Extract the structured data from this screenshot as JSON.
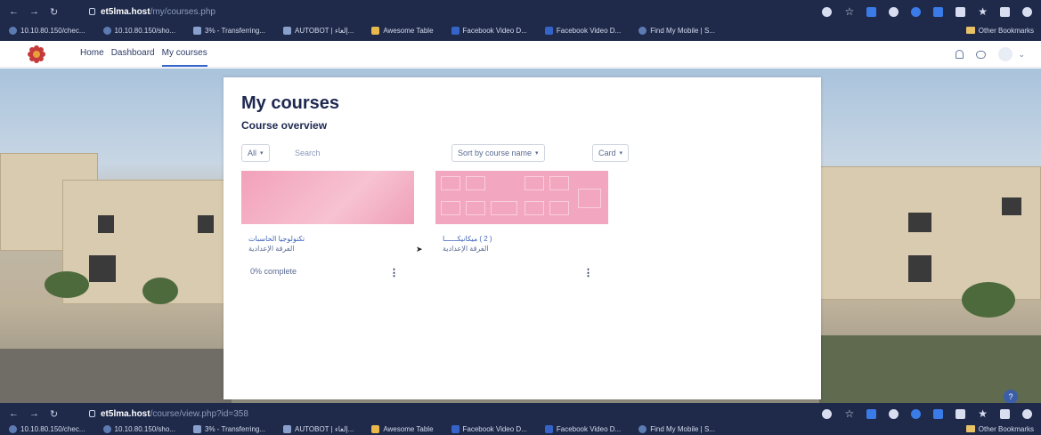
{
  "browser_top": {
    "url_host": "et5lma.host",
    "url_path": "/my/courses.php",
    "bookmarks": [
      "10.10.80.150/chec...",
      "10.10.80.150/sho...",
      "3% - Transferring...",
      "AUTOBOT | إلغاء...",
      "Awesome Table",
      "Facebook Video D...",
      "Facebook Video D...",
      "Find My Mobile | S..."
    ],
    "other_bookmarks": "Other Bookmarks"
  },
  "browser_bottom": {
    "url_host": "et5lma.host",
    "url_path": "/course/view.php?id=358",
    "bookmarks": [
      "10.10.80.150/chec...",
      "10.10.80.150/sho...",
      "3% - Transferring...",
      "AUTOBOT | إلغاء...",
      "Awesome Table",
      "Facebook Video D...",
      "Facebook Video D...",
      "Find My Mobile | S..."
    ],
    "other_bookmarks": "Other Bookmarks"
  },
  "navbar": {
    "links": [
      "Home",
      "Dashboard",
      "My courses"
    ],
    "active": "My courses"
  },
  "main": {
    "title": "My courses",
    "section": "Course overview",
    "filter_all": "All",
    "search": "Search",
    "sort": "Sort by course name",
    "view": "Card"
  },
  "courses": [
    {
      "name": "تكنولوجيا الحاسبات",
      "category": "الفرقة الإعدادية",
      "progress": "0% complete"
    },
    {
      "name": "( 2 ) ميكانيكــــــا",
      "category": "الفرقة الإعدادية"
    }
  ],
  "colors": {
    "chrome": "#1f2a4a",
    "link": "#3d62b8",
    "course_image": "#ef9db6"
  }
}
